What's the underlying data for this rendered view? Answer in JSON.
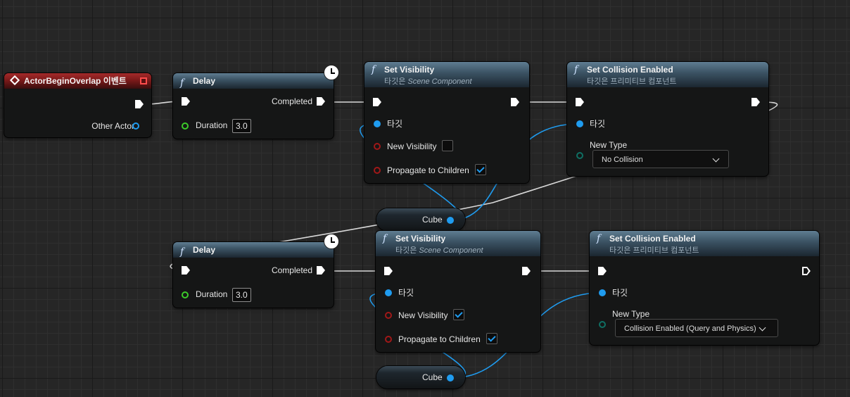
{
  "event_node": {
    "title": "ActorBeginOverlap 이벤트",
    "other_actor_label": "Other Actor"
  },
  "delay_1": {
    "title": "Delay",
    "completed_label": "Completed",
    "duration_label": "Duration",
    "duration_value": "3.0"
  },
  "delay_2": {
    "title": "Delay",
    "completed_label": "Completed",
    "duration_label": "Duration",
    "duration_value": "3.0"
  },
  "set_visibility_1": {
    "title": "Set Visibility",
    "subtitle_prefix": "타깃은 ",
    "subtitle_target": "Scene Component",
    "target_label": "타깃",
    "new_visibility_label": "New Visibility",
    "new_visibility_checked": false,
    "propagate_label": "Propagate to Children",
    "propagate_checked": true
  },
  "set_visibility_2": {
    "title": "Set Visibility",
    "subtitle_prefix": "타깃은 ",
    "subtitle_target": "Scene Component",
    "target_label": "타깃",
    "new_visibility_label": "New Visibility",
    "new_visibility_checked": true,
    "propagate_label": "Propagate to Children",
    "propagate_checked": true
  },
  "set_collision_1": {
    "title": "Set Collision Enabled",
    "subtitle": "타깃은 프리미티브 컴포넌트",
    "target_label": "타깃",
    "new_type_label": "New Type",
    "new_type_value": "No Collision"
  },
  "set_collision_2": {
    "title": "Set Collision Enabled",
    "subtitle": "타깃은 프리미티브 컴포넌트",
    "target_label": "타깃",
    "new_type_label": "New Type",
    "new_type_value": "Collision Enabled (Query and Physics)"
  },
  "cube_1": {
    "label": "Cube"
  },
  "cube_2": {
    "label": "Cube"
  },
  "colors": {
    "exec_wire": "#d9d9d9",
    "object_wire": "#1f9cf0",
    "event_header": "#a42a2a",
    "function_header": "#4c6a80"
  },
  "icons": {
    "function": "function-icon",
    "event": "event-diamond-icon",
    "latent": "clock-icon"
  }
}
